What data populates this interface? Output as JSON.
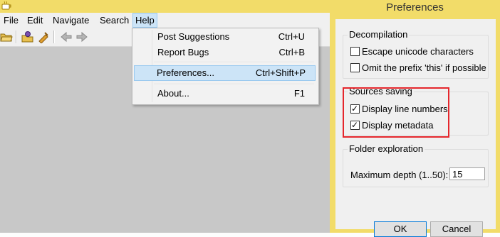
{
  "menubar": {
    "items": [
      "File",
      "Edit",
      "Navigate",
      "Search",
      "Help"
    ]
  },
  "help_menu": {
    "items": [
      {
        "label": "Post Suggestions",
        "shortcut": "Ctrl+U"
      },
      {
        "label": "Report Bugs",
        "shortcut": "Ctrl+B"
      },
      {
        "label": "Preferences...",
        "shortcut": "Ctrl+Shift+P"
      },
      {
        "label": "About...",
        "shortcut": "F1"
      }
    ],
    "highlighted": "Preferences..."
  },
  "toolbar": {
    "icons": [
      "open-folder-icon",
      "open-type-icon",
      "open-jar-icon",
      "back-arrow-icon",
      "forward-arrow-icon"
    ]
  },
  "preferences": {
    "title": "Preferences",
    "decompilation": {
      "legend": "Decompilation",
      "escape_unicode": {
        "label": "Escape unicode characters",
        "checked": false
      },
      "omit_this": {
        "label": "Omit the prefix 'this' if possible",
        "checked": false
      }
    },
    "sources_saving": {
      "legend": "Sources saving",
      "line_numbers": {
        "label": "Display line numbers",
        "checked": true
      },
      "metadata": {
        "label": "Display metadata",
        "checked": true
      }
    },
    "folder_exploration": {
      "legend": "Folder exploration",
      "depth_label": "Maximum depth (1..50):",
      "depth_value": "15"
    },
    "ok_label": "OK",
    "cancel_label": "Cancel"
  },
  "colors": {
    "title_bar": "#f2dc69",
    "highlight_outline": "#e5262c",
    "menu_highlight": "#cce4f7"
  }
}
